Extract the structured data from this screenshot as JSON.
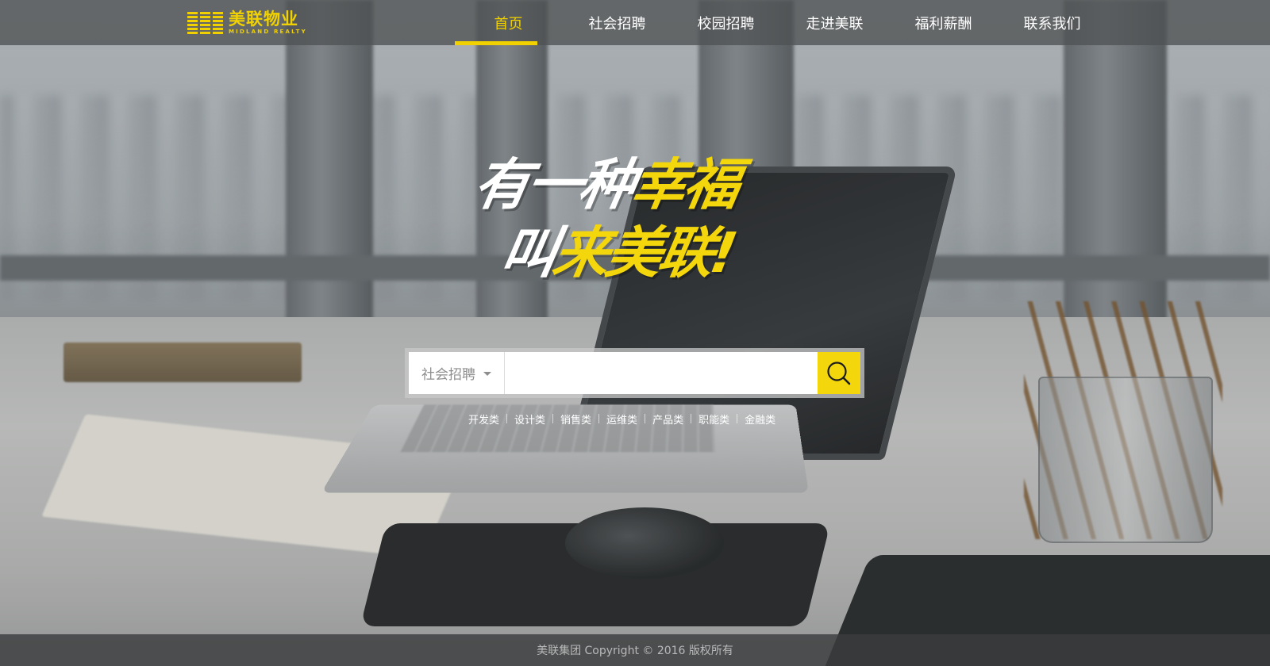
{
  "header": {
    "logo": {
      "cn": "美联物业",
      "en": "MIDLAND REALTY"
    },
    "nav": [
      {
        "label": "首页",
        "active": true
      },
      {
        "label": "社会招聘",
        "active": false
      },
      {
        "label": "校园招聘",
        "active": false
      },
      {
        "label": "走进美联",
        "active": false
      },
      {
        "label": "福利薪酬",
        "active": false
      },
      {
        "label": "联系我们",
        "active": false
      }
    ]
  },
  "hero": {
    "slogan": {
      "line1_white": "有一种",
      "line1_yellow": "幸福",
      "line2_white": "叫",
      "line2_yellow": "来美联!"
    }
  },
  "search": {
    "category": "社会招聘",
    "value": "",
    "placeholder": "",
    "button_icon": "search-icon"
  },
  "tags": [
    "开发类",
    "设计类",
    "销售类",
    "运维类",
    "产品类",
    "职能类",
    "金融类"
  ],
  "footer": {
    "copyright": "美联集团 Copyright © 2016 版权所有"
  },
  "colors": {
    "accent": "#f3d60c",
    "header_bg": "#505253",
    "footer_bg": "#3a3c3d"
  }
}
